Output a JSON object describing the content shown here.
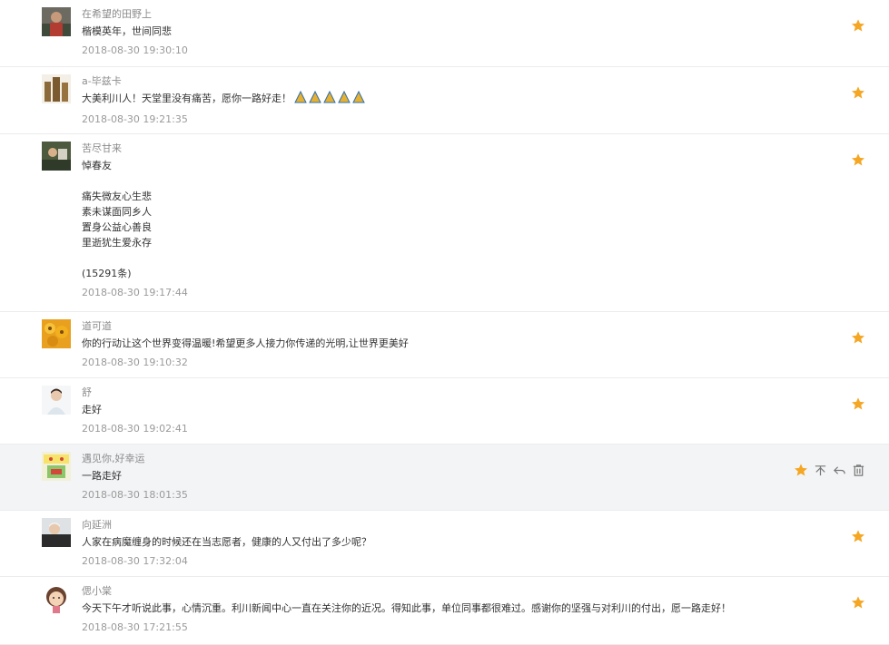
{
  "comments": [
    {
      "author": "在希望的田野上",
      "text": "楷模英年，世间同悲",
      "time": "2018-08-30 19:30:10"
    },
    {
      "author": "a-毕兹卡",
      "text": "大美利川人！天堂里没有痛苦，愿你一路好走！",
      "time": "2018-08-30 19:21:35",
      "emoji_count": 5
    },
    {
      "author": "苦尽甘来",
      "text": "悼春友\n\n痛失微友心生悲\n素未谋面同乡人\n置身公益心善良\n里逝犹生爱永存\n\n(15291条)",
      "time": "2018-08-30 19:17:44"
    },
    {
      "author": "道可道",
      "text": "你的行动让这个世界变得温暖!希望更多人接力你传递的光明,让世界更美好",
      "time": "2018-08-30 19:10:32"
    },
    {
      "author": "舒",
      "text": "走好",
      "time": "2018-08-30 19:02:41"
    },
    {
      "author": "遇见你,好幸运",
      "text": "一路走好",
      "time": "2018-08-30 18:01:35",
      "hovered": true
    },
    {
      "author": "向延洲",
      "text": "人家在病魔缠身的时候还在当志愿者，健康的人又付出了多少呢？",
      "time": "2018-08-30 17:32:04"
    },
    {
      "author": "偲小棠",
      "text": "今天下午才听说此事，心情沉重。利川新闻中心一直在关注你的近况。得知此事，单位同事都很难过。感谢你的坚强与对利川的付出，愿一路走好！",
      "time": "2018-08-30 17:21:55"
    }
  ],
  "icons": {
    "star": "star-icon",
    "dislike": "thumbs-down-icon",
    "reply": "reply-icon",
    "delete": "trash-icon"
  },
  "colors": {
    "star": "#f5a623",
    "hover_bg": "#f3f4f6",
    "author": "#8c8c8c",
    "time": "#9a9a9a"
  }
}
